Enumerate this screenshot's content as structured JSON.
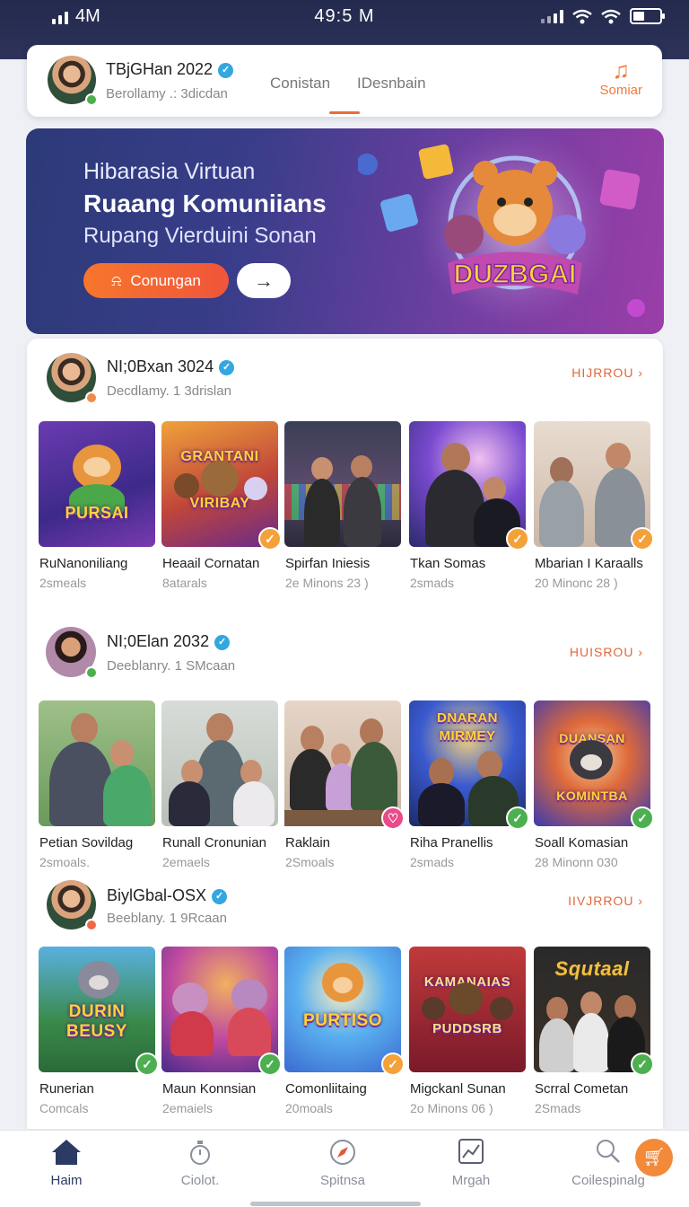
{
  "status_bar": {
    "carrier": "4M",
    "time": "49:5 M"
  },
  "header": {
    "name": "TBjGHan 2022",
    "subtitle": "Berollamy .: 3dicdan",
    "tabs": [
      "Conistan",
      "IDesnbain"
    ],
    "action_label": "Somiar"
  },
  "banner": {
    "line1": "Hibarasia Virtuan",
    "line2": "Ruaang Komuniians",
    "line3": "Rupang Vierduini Sonan",
    "button_label": "Conungan",
    "art_label": "DUZBGAI"
  },
  "sections": [
    {
      "name": "NI;0Bxan 3024",
      "subtitle": "Decdlamy. 1 3drislan",
      "more": "HIJRROU",
      "cards": [
        {
          "title": "RuNanoniliang",
          "sub": "2smeals",
          "art": "PURSAI"
        },
        {
          "title": "Heaail Cornatan",
          "sub": "8atarals",
          "art": "GRANTANI VIRIBAY"
        },
        {
          "title": "Spirfan Iniesis",
          "sub": "2e Minons 23 )",
          "art": ""
        },
        {
          "title": "Tkan Somas",
          "sub": "2smads",
          "art": ""
        },
        {
          "title": "Mbarian I Karaalls",
          "sub": "20 Minonc 28 )",
          "art": ""
        }
      ]
    },
    {
      "name": "NI;0Elan 2032",
      "subtitle": "Deeblanry. 1 SMcaan",
      "more": "HUISROU",
      "cards": [
        {
          "title": "Petian Sovildag",
          "sub": "2smoals.",
          "art": ""
        },
        {
          "title": "Runall Cronunian",
          "sub": "2emaels",
          "art": ""
        },
        {
          "title": "Raklain",
          "sub": "2Smoals",
          "art": ""
        },
        {
          "title": "Riha Pranellis",
          "sub": "2smads",
          "art": "DNARAN MIRMEY"
        },
        {
          "title": "Soall Komasian",
          "sub": "28 Minonn 030",
          "art": "DUANSAN KOMINTBA"
        }
      ]
    },
    {
      "name": "BiylGbal-OSX",
      "subtitle": "Beeblany. 1 9Rcaan",
      "more": "IIVJRROU",
      "cards": [
        {
          "title": "Runerian",
          "sub": "Comcals",
          "art": "DURIN BEUSY"
        },
        {
          "title": "Maun Konnsian",
          "sub": "2emaiels",
          "art": ""
        },
        {
          "title": "Comonliitaing",
          "sub": "20moals",
          "art": "PURTISO"
        },
        {
          "title": "Migckanl Sunan",
          "sub": "2o Minons 06 )",
          "art": "KAMANAIAS PUDDSRB"
        },
        {
          "title": "Scrral Cometan",
          "sub": "2Smads",
          "art": "Squtaal"
        }
      ]
    }
  ],
  "bottom_nav": [
    {
      "label": "Haim",
      "icon": "home-icon"
    },
    {
      "label": "Ciolot.",
      "icon": "timer-icon"
    },
    {
      "label": "Spitnsa",
      "icon": "compass-icon"
    },
    {
      "label": "Mrgah",
      "icon": "chart-icon"
    },
    {
      "label": "Coilespinalg",
      "icon": "search-icon"
    }
  ],
  "colors": {
    "accent": "#f06a3a",
    "status_bar": "#2a2f55",
    "verified": "#33a7e0",
    "badge_green": "#4caf50",
    "badge_orange": "#f5a13a",
    "badge_pink": "#e84a8a"
  }
}
